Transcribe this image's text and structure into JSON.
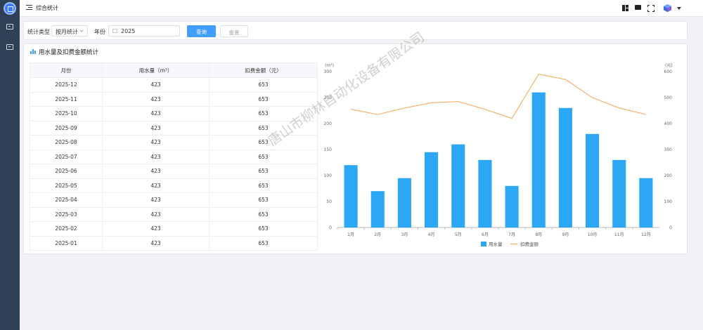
{
  "header": {
    "title": "综合统计"
  },
  "filter": {
    "type_label": "统计类型",
    "type_value": "按月统计",
    "year_label": "年份",
    "year_value": "2025",
    "query_label": "查询",
    "reset_label": "重置"
  },
  "panel": {
    "title": "用水量及扣费金额统计"
  },
  "table": {
    "headers": [
      "月份",
      "用水量（m³）",
      "扣费金额（元）"
    ],
    "rows": [
      [
        "2025-12",
        "423",
        "653"
      ],
      [
        "2025-11",
        "423",
        "653"
      ],
      [
        "2025-10",
        "423",
        "653"
      ],
      [
        "2025-09",
        "423",
        "653"
      ],
      [
        "2025-08",
        "423",
        "653"
      ],
      [
        "2025-07",
        "423",
        "653"
      ],
      [
        "2025-06",
        "423",
        "653"
      ],
      [
        "2025-05",
        "423",
        "653"
      ],
      [
        "2025-04",
        "423",
        "653"
      ],
      [
        "2025-03",
        "423",
        "653"
      ],
      [
        "2025-02",
        "423",
        "653"
      ],
      [
        "2025-01",
        "423",
        "653"
      ]
    ]
  },
  "watermark": "唐山市柳林自动化设备有限公司",
  "colors": {
    "primary": "#409eff",
    "bar": "#2ba7f5",
    "line": "#f5b26b",
    "sidebar": "#2f3f55"
  },
  "chart_data": {
    "type": "bar",
    "categories": [
      "1月",
      "2月",
      "3月",
      "4月",
      "5月",
      "6月",
      "7月",
      "8月",
      "9月",
      "10月",
      "11月",
      "12月"
    ],
    "series": [
      {
        "name": "用水量",
        "type": "bar",
        "axis": "left",
        "values": [
          120,
          70,
          95,
          145,
          160,
          130,
          80,
          260,
          230,
          180,
          130,
          95
        ]
      },
      {
        "name": "扣费金额",
        "type": "line",
        "axis": "right",
        "values": [
          455,
          435,
          460,
          480,
          485,
          455,
          420,
          590,
          570,
          500,
          460,
          435
        ]
      }
    ],
    "left_axis": {
      "unit": "(m³)",
      "ylim": [
        0,
        300
      ],
      "ticks": [
        "0",
        "50",
        "100",
        "150",
        "200",
        "250",
        "300"
      ]
    },
    "right_axis": {
      "unit": "(元)",
      "ylim": [
        0,
        600
      ],
      "ticks": [
        "0",
        "100",
        "200",
        "300",
        "400",
        "500",
        "600"
      ]
    },
    "legend_position": "bottom-center",
    "grid": false
  }
}
